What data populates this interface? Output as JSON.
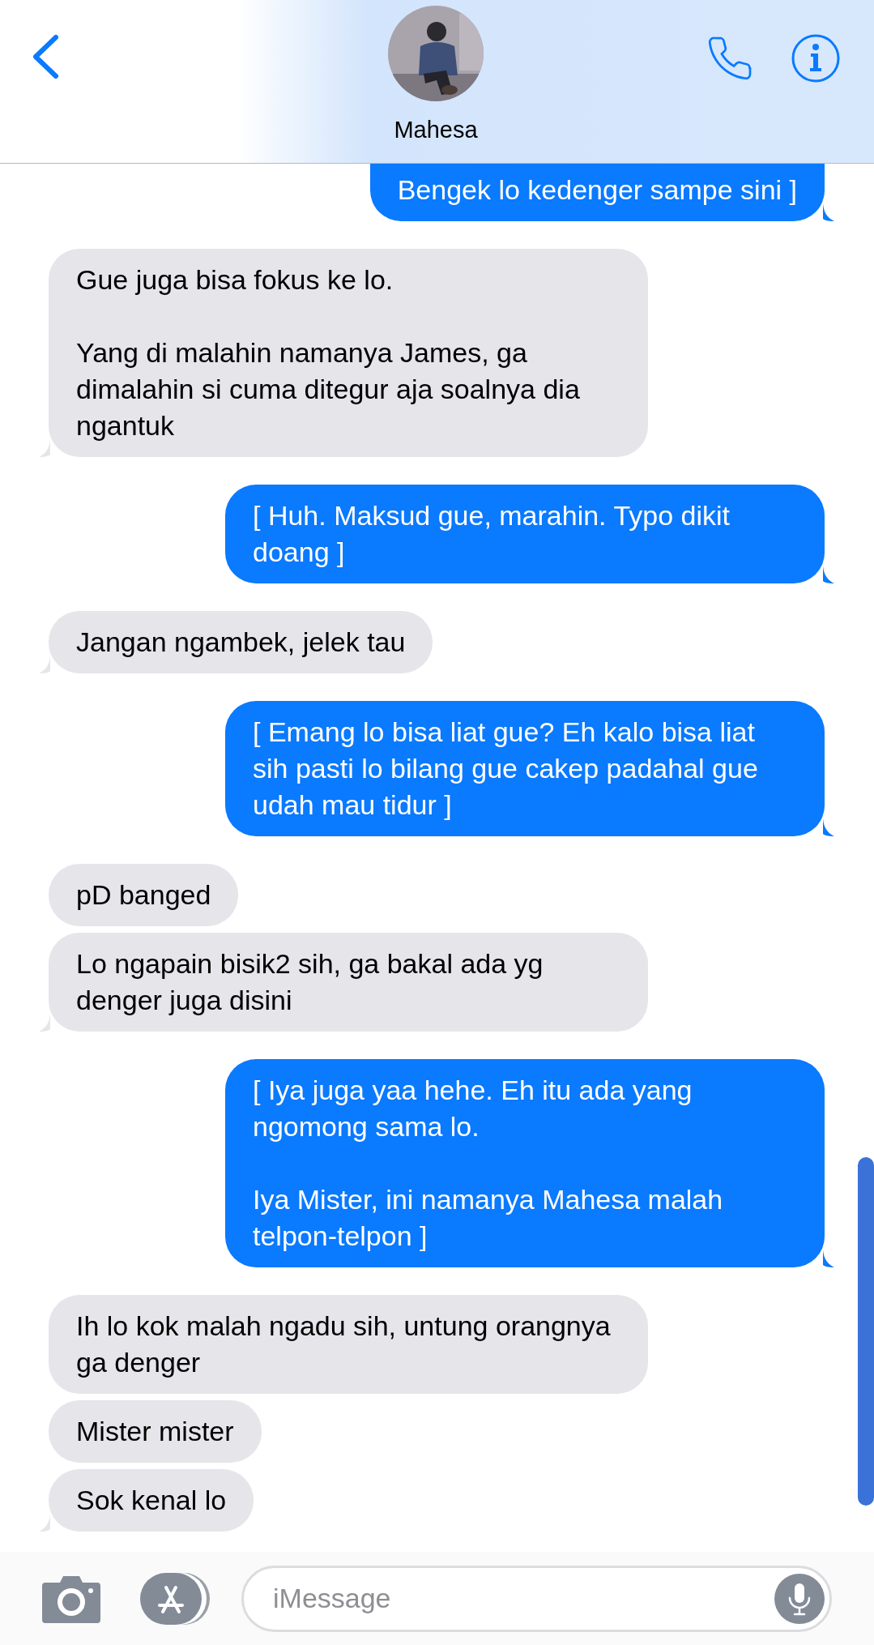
{
  "header": {
    "contact_name": "Mahesa"
  },
  "messages": [
    {
      "kind": "sent",
      "text": "Bengek lo kedenger sampe sini ]",
      "cut_top": true
    },
    {
      "kind": "received",
      "text": "Gue juga bisa fokus ke lo.\n\nYang di malahin namanya James, ga dimalahin si cuma ditegur aja soalnya dia ngantuk"
    },
    {
      "kind": "sent",
      "text": "[ Huh. Maksud gue, marahin. Typo dikit doang ]"
    },
    {
      "kind": "received",
      "text": "Jangan ngambek, jelek tau"
    },
    {
      "kind": "sent",
      "text": "[ Emang lo bisa liat gue? Eh kalo bisa liat sih pasti lo bilang gue cakep padahal gue udah mau tidur ]"
    },
    {
      "kind": "received",
      "text": "pD banged"
    },
    {
      "kind": "received",
      "text": "Lo ngapain bisik2 sih, ga bakal ada yg denger juga disini"
    },
    {
      "kind": "sent",
      "text": "[ Iya juga yaa hehe. Eh itu ada yang ngomong sama lo.\n\nIya Mister, ini namanya Mahesa malah telpon-telpon ]"
    },
    {
      "kind": "received",
      "text": "Ih lo kok malah ngadu sih, untung orangnya ga denger"
    },
    {
      "kind": "received",
      "text": "Mister mister"
    },
    {
      "kind": "received",
      "text": "Sok kenal lo"
    }
  ],
  "composer": {
    "placeholder": "iMessage"
  }
}
